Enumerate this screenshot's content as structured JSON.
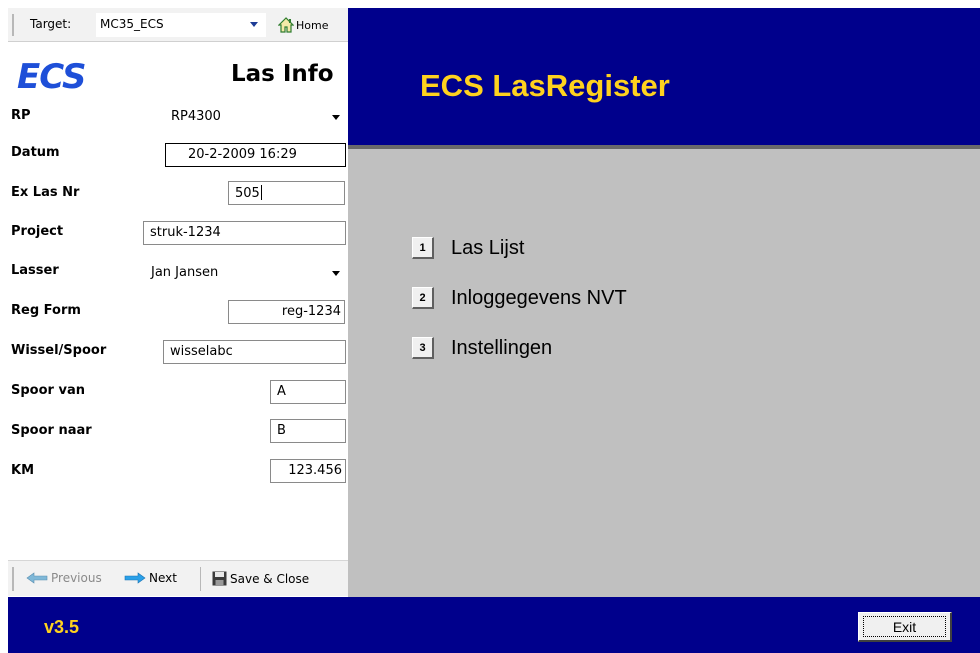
{
  "toolbar": {
    "target_label": "Target:",
    "target_value": "MC35_ECS",
    "home_label": "Home"
  },
  "brand": "ECS",
  "page_title": "Las Info",
  "fields": [
    {
      "label": "RP",
      "value": "RP4300"
    },
    {
      "label": "Datum",
      "value": "20-2-2009 16:29"
    },
    {
      "label": "Ex Las Nr",
      "value": "505"
    },
    {
      "label": "Project",
      "value": "struk-1234"
    },
    {
      "label": "Lasser",
      "value": "Jan Jansen"
    },
    {
      "label": "Reg Form",
      "value": "reg-1234"
    },
    {
      "label": "Wissel/Spoor",
      "value": "wisselabc"
    },
    {
      "label": "Spoor van",
      "value": "A"
    },
    {
      "label": "Spoor naar",
      "value": "B"
    },
    {
      "label": "KM",
      "value": "123.456"
    }
  ],
  "bottom_bar": {
    "previous": "Previous",
    "next": "Next",
    "save_close": "Save & Close"
  },
  "app_title": "ECS LasRegister",
  "menu": [
    {
      "num": "1",
      "label": "Las Lijst"
    },
    {
      "num": "2",
      "label": "Inloggegevens NVT"
    },
    {
      "num": "3",
      "label": "Instellingen"
    }
  ],
  "footer": {
    "version": "v3.5",
    "exit_label": "Exit"
  },
  "colors": {
    "header_bg": "#00008c",
    "title_yellow": "#ffd21e",
    "content_gray": "#c0c0c0",
    "brand_blue": "#1e4fd8"
  }
}
